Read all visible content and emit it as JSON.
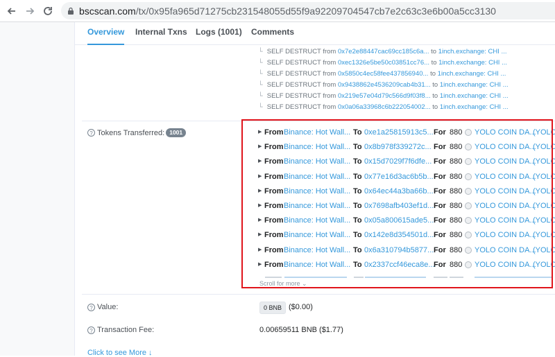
{
  "browser": {
    "domain": "bscscan.com",
    "path": "/tx/0x95fa965d71275cb231548055d55f9a92209704547cb7e2c63c3e6b00a5cc3130"
  },
  "tabs": [
    {
      "label": "Overview",
      "active": true
    },
    {
      "label": "Internal Txns",
      "active": false
    },
    {
      "label": "Logs (1001)",
      "active": false
    },
    {
      "label": "Comments",
      "active": false
    }
  ],
  "self_destructs": [
    {
      "label": "SELF DESTRUCT",
      "from_word": "from",
      "from": "0x7e2e88447cac69cc185c6a...",
      "to_word": "to",
      "to": "1inch.exchange: CHI ..."
    },
    {
      "label": "SELF DESTRUCT",
      "from_word": "from",
      "from": "0xec1326e5be50c03851cc76...",
      "to_word": "to",
      "to": "1inch.exchange: CHI ..."
    },
    {
      "label": "SELF DESTRUCT",
      "from_word": "from",
      "from": "0x5850c4ec58fee437856940...",
      "to_word": "to",
      "to": "1inch.exchange: CHI ..."
    },
    {
      "label": "SELF DESTRUCT",
      "from_word": "from",
      "from": "0x9438862e4536209cab4b31...",
      "to_word": "to",
      "to": "1inch.exchange: CHI ..."
    },
    {
      "label": "SELF DESTRUCT",
      "from_word": "from",
      "from": "0x219e57e04d79c566d9f03f8...",
      "to_word": "to",
      "to": "1inch.exchange: CHI ..."
    },
    {
      "label": "SELF DESTRUCT",
      "from_word": "from",
      "from": "0x0a06a33968c6b222054002...",
      "to_word": "to",
      "to": "1inch.exchange: CHI ..."
    }
  ],
  "tokens_transferred": {
    "label": "Tokens Transferred:",
    "count": "1001",
    "from_word": "From",
    "to_word": "To",
    "for_word": "For",
    "rows": [
      {
        "from": "Binance: Hot Wall...",
        "to": "0xe1a25815913c5...",
        "amount": "880",
        "token": "YOLO COIN DA...",
        "symbol": "(YOLO"
      },
      {
        "from": "Binance: Hot Wall...",
        "to": "0x8b978f339272c...",
        "amount": "880",
        "token": "YOLO COIN DA...",
        "symbol": "(YOLO"
      },
      {
        "from": "Binance: Hot Wall...",
        "to": "0x15d7029f7f6dfe...",
        "amount": "880",
        "token": "YOLO COIN DA...",
        "symbol": "(YOLO"
      },
      {
        "from": "Binance: Hot Wall...",
        "to": "0x77e16d3ac6b5b...",
        "amount": "880",
        "token": "YOLO COIN DA...",
        "symbol": "(YOLO"
      },
      {
        "from": "Binance: Hot Wall...",
        "to": "0x64ec44a3ba66b...",
        "amount": "880",
        "token": "YOLO COIN DA...",
        "symbol": "(YOLO"
      },
      {
        "from": "Binance: Hot Wall...",
        "to": "0x7698afb403ef1d...",
        "amount": "880",
        "token": "YOLO COIN DA...",
        "symbol": "(YOLO"
      },
      {
        "from": "Binance: Hot Wall...",
        "to": "0x05a800615ade5...",
        "amount": "880",
        "token": "YOLO COIN DA...",
        "symbol": "(YOLO"
      },
      {
        "from": "Binance: Hot Wall...",
        "to": "0x142e8d354501d...",
        "amount": "880",
        "token": "YOLO COIN DA...",
        "symbol": "(YOLO"
      },
      {
        "from": "Binance: Hot Wall...",
        "to": "0x6a310794b5877...",
        "amount": "880",
        "token": "YOLO COIN DA...",
        "symbol": "(YOLO"
      },
      {
        "from": "Binance: Hot Wall...",
        "to": "0x2337ccf46eca8e...",
        "amount": "880",
        "token": "YOLO COIN DA...",
        "symbol": "(YOLO"
      }
    ],
    "scroll_more": "Scroll for more"
  },
  "value": {
    "label": "Value:",
    "badge": "0 BNB",
    "usd": "($0.00)"
  },
  "fee": {
    "label": "Transaction Fee:",
    "value": "0.00659511 BNB ($1.77)"
  },
  "see_more": "Click to see More",
  "icons": {
    "back": "back-arrow-icon",
    "forward": "forward-arrow-icon",
    "reload": "reload-icon",
    "lock": "lock-icon",
    "help": "question-circle-icon",
    "token": "token-icon",
    "expand": "chevron-down-icon"
  },
  "colors": {
    "link": "#3498db",
    "highlight_box": "#e0141b",
    "badge": "#77838f"
  }
}
